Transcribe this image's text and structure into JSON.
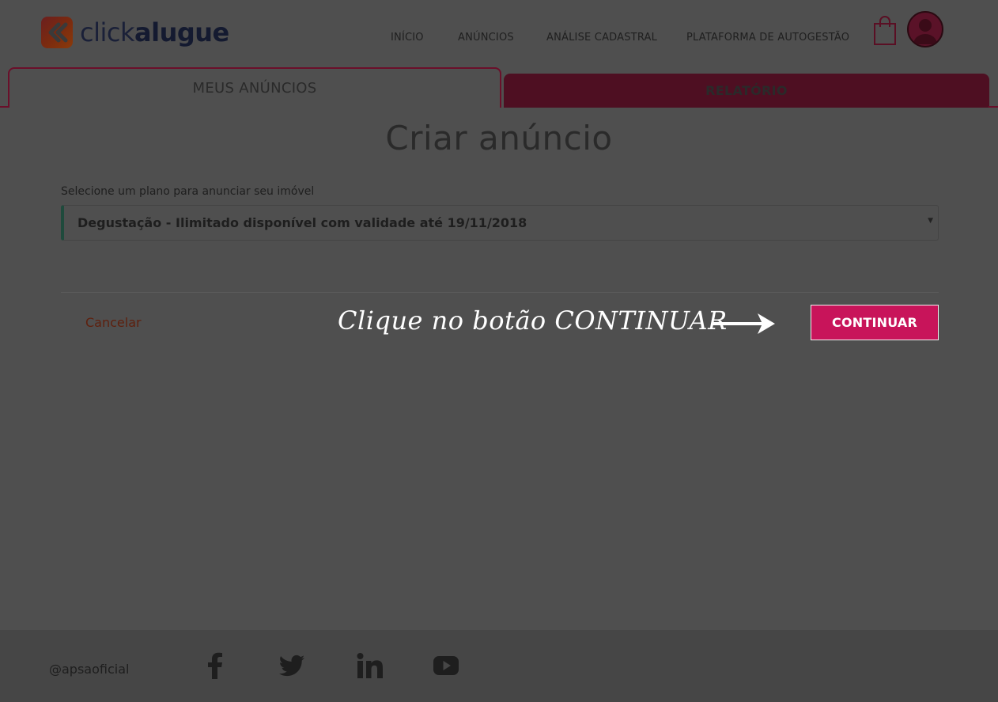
{
  "brand": {
    "name_part1": "click",
    "name_part2": "alugue"
  },
  "nav": {
    "items": [
      {
        "label": "INÍCIO"
      },
      {
        "label": "ANÚNCIOS"
      },
      {
        "label": "ANÁLISE CADASTRAL"
      },
      {
        "label": "PLATAFORMA DE AUTOGESTÃO"
      }
    ],
    "icons": [
      "shopping-bag-icon",
      "user-avatar-icon"
    ]
  },
  "tabs": [
    {
      "label": "MEUS ANÚNCIOS",
      "active": true
    },
    {
      "label": "RELATÓRIO",
      "active": false
    }
  ],
  "main": {
    "title": "Criar anúncio",
    "plan_select": {
      "label": "Selecione um plano para anunciar seu imóvel",
      "value": "Degustação - Ilimitado disponível com validade até 19/11/2018"
    },
    "cancel_label": "Cancelar",
    "continue_label": "CONTINUAR",
    "annotation": "Clique no botão CONTINUAR"
  },
  "footer": {
    "handle": "@apsaoficial",
    "social_icons": [
      "facebook-icon",
      "twitter-icon",
      "linkedin-icon",
      "youtube-icon"
    ]
  },
  "colors": {
    "accent": "#c8145a",
    "tab_inactive": "#4e0f22",
    "overlay_background": "#4f4f4f",
    "select_accent": "#1f4a3c"
  }
}
